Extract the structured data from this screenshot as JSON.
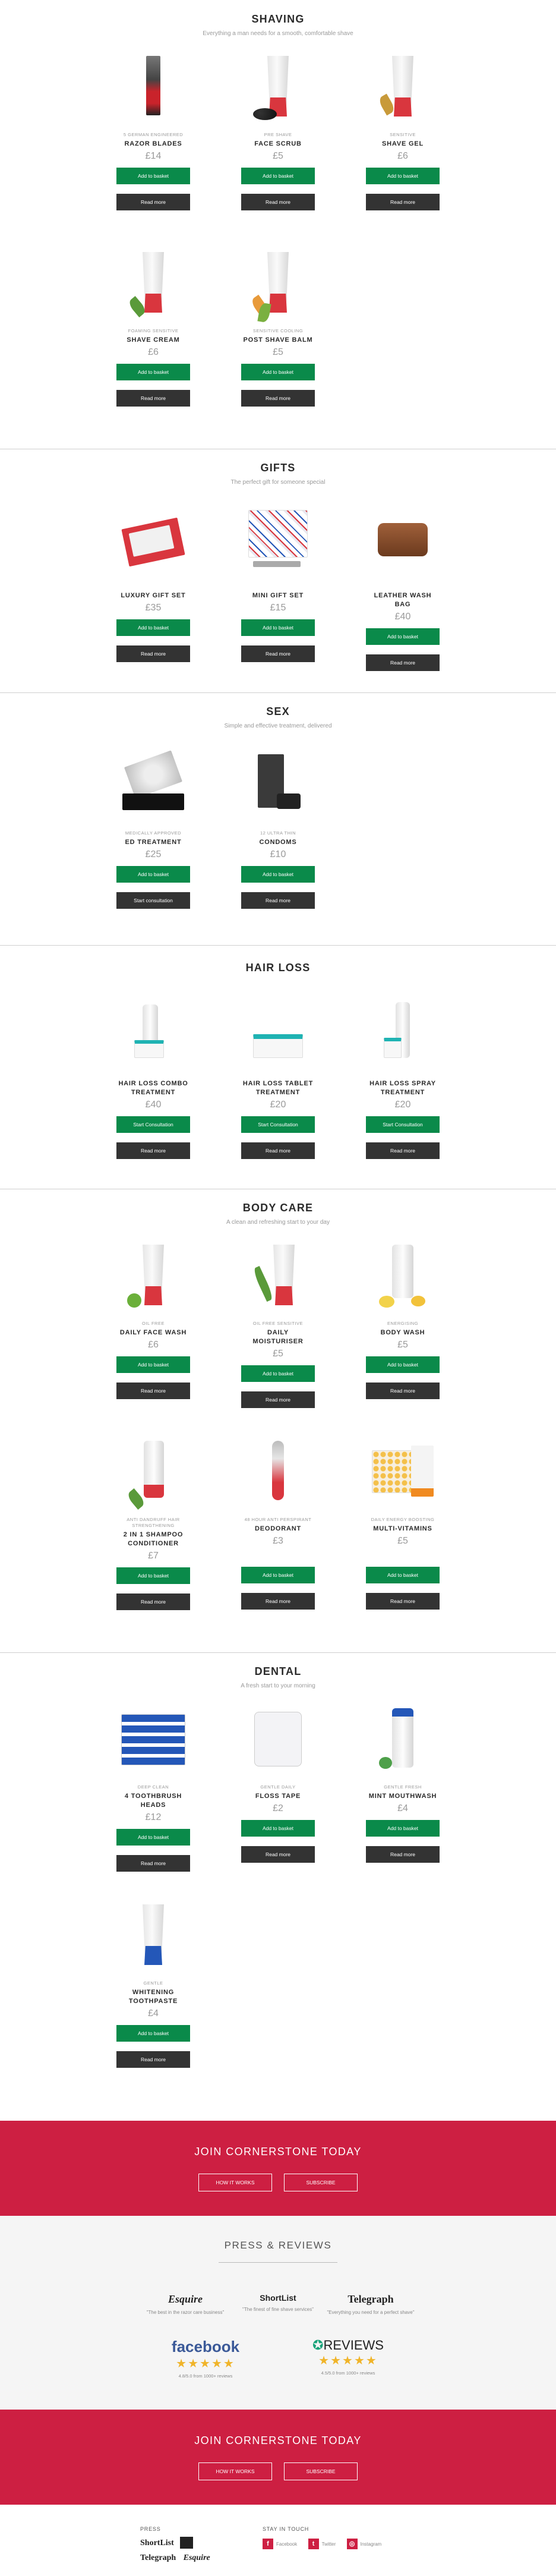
{
  "shaving": {
    "title": "SHAVING",
    "subtitle": "Everything a man needs for a smooth, comfortable shave",
    "products": [
      {
        "tag": "5 GERMAN ENGINEERED",
        "name": "RAZOR BLADES",
        "price": "£14",
        "btn1": "Add to basket",
        "btn2": "Read more"
      },
      {
        "tag": "PRE SHAVE",
        "name": "FACE SCRUB",
        "price": "£5",
        "btn1": "Add to basket",
        "btn2": "Read more"
      },
      {
        "tag": "SENSITIVE",
        "name": "SHAVE GEL",
        "price": "£6",
        "btn1": "Add to basket",
        "btn2": "Read more"
      },
      {
        "tag": "FOAMING SENSITIVE",
        "name": "SHAVE CREAM",
        "price": "£6",
        "btn1": "Add to basket",
        "btn2": "Read more"
      },
      {
        "tag": "SENSITIVE COOLING",
        "name": "POST SHAVE BALM",
        "price": "£5",
        "btn1": "Add to basket",
        "btn2": "Read more"
      }
    ]
  },
  "gifts": {
    "title": "GIFTS",
    "subtitle": "The perfect gift for someone special",
    "products": [
      {
        "tag": "",
        "name": "LUXURY GIFT SET",
        "price": "£35",
        "btn1": "Add to basket",
        "btn2": "Read more"
      },
      {
        "tag": "",
        "name": "MINI GIFT SET",
        "price": "£15",
        "btn1": "Add to basket",
        "btn2": "Read more"
      },
      {
        "tag": "",
        "name": "LEATHER WASH BAG",
        "price": "£40",
        "btn1": "Add to basket",
        "btn2": "Read more"
      }
    ]
  },
  "sex": {
    "title": "SEX",
    "subtitle": "Simple and effective treatment, delivered",
    "products": [
      {
        "tag": "MEDICALLY APPROVED",
        "name": "ED TREATMENT",
        "price": "£25",
        "btn1": "Add to basket",
        "btn2": "Start consultation"
      },
      {
        "tag": "12 ULTRA THIN",
        "name": "CONDOMS",
        "price": "£10",
        "btn1": "Add to basket",
        "btn2": "Read more"
      }
    ]
  },
  "hairloss": {
    "title": "HAIR LOSS",
    "products": [
      {
        "name": "HAIR LOSS COMBO TREATMENT",
        "price": "£40",
        "btn1": "Start Consultation",
        "btn2": "Read more"
      },
      {
        "name": "HAIR LOSS TABLET TREATMENT",
        "price": "£20",
        "btn1": "Start Consultation",
        "btn2": "Read more"
      },
      {
        "name": "HAIR LOSS SPRAY TREATMENT",
        "price": "£20",
        "btn1": "Start Consultation",
        "btn2": "Read more"
      }
    ]
  },
  "bodycare": {
    "title": "BODY CARE",
    "subtitle": "A clean and refreshing start to your day",
    "products": [
      {
        "tag": "OIL FREE",
        "name": "DAILY FACE WASH",
        "price": "£6",
        "btn1": "Add to basket",
        "btn2": "Read more"
      },
      {
        "tag": "OIL FREE SENSITIVE",
        "name": "DAILY MOISTURISER",
        "price": "£5",
        "btn1": "Add to basket",
        "btn2": "Read more"
      },
      {
        "tag": "ENERGISING",
        "name": "BODY WASH",
        "price": "£5",
        "btn1": "Add to basket",
        "btn2": "Read more"
      },
      {
        "tag": "ANTI DANDRUFF HAIR STRENGTHENING",
        "name": "2 IN 1 SHAMPOO CONDITIONER",
        "price": "£7",
        "btn1": "Add to basket",
        "btn2": "Read more"
      },
      {
        "tag": "48 HOUR ANTI PERSPIRANT",
        "name": "DEODORANT",
        "price": "£3",
        "btn1": "Add to basket",
        "btn2": "Read more"
      },
      {
        "tag": "DAILY ENERGY BOOSTING",
        "name": "MULTI-VITAMINS",
        "price": "£5",
        "btn1": "Add to basket",
        "btn2": "Read more"
      }
    ]
  },
  "dental": {
    "title": "DENTAL",
    "subtitle": "A fresh start to your morning",
    "products": [
      {
        "tag": "DEEP CLEAN",
        "name": "4 TOOTHBRUSH HEADS",
        "price": "£12",
        "btn1": "Add to basket",
        "btn2": "Read more"
      },
      {
        "tag": "GENTLE DAILY",
        "name": "FLOSS TAPE",
        "price": "£2",
        "btn1": "Add to basket",
        "btn2": "Read more"
      },
      {
        "tag": "GENTLE FRESH",
        "name": "MINT MOUTHWASH",
        "price": "£4",
        "btn1": "Add to basket",
        "btn2": "Read more"
      },
      {
        "tag": "GENTLE",
        "name": "WHITENING TOOTHPASTE",
        "price": "£4",
        "btn1": "Add to basket",
        "btn2": "Read more"
      }
    ]
  },
  "cta": {
    "title": "JOIN CORNERSTONE TODAY",
    "how": "HOW IT WORKS",
    "subscribe": "SUBSCRIBE"
  },
  "press": {
    "title": "PRESS & REVIEWS",
    "quotes": [
      {
        "logo": "Esquire",
        "text": "\"The best in the razor care business\""
      },
      {
        "logo": "ShortList",
        "text": "\"The finest of fine shave services\""
      },
      {
        "logo": "Telegraph",
        "text": "\"Everything you need for a perfect shave\""
      }
    ],
    "reviews": [
      {
        "logo": "facebook",
        "stars": "★★★★★",
        "count": "4.8/5.0 from 1000+ reviews"
      },
      {
        "logo": "REVIEWS",
        "stars": "★★★★★",
        "count": "4.5/5.0 from 1000+ reviews"
      }
    ]
  },
  "footer": {
    "press_head": "PRESS",
    "touch_head": "STAY IN TOUCH",
    "press_logos": [
      "ShortList",
      "Telegraph",
      "Esquire"
    ],
    "social": [
      {
        "icon": "facebook-icon",
        "glyph": "f",
        "label": "Facebook"
      },
      {
        "icon": "twitter-icon",
        "glyph": "t",
        "label": "Twitter"
      },
      {
        "icon": "instagram-icon",
        "glyph": "◎",
        "label": "Instagram"
      }
    ]
  }
}
